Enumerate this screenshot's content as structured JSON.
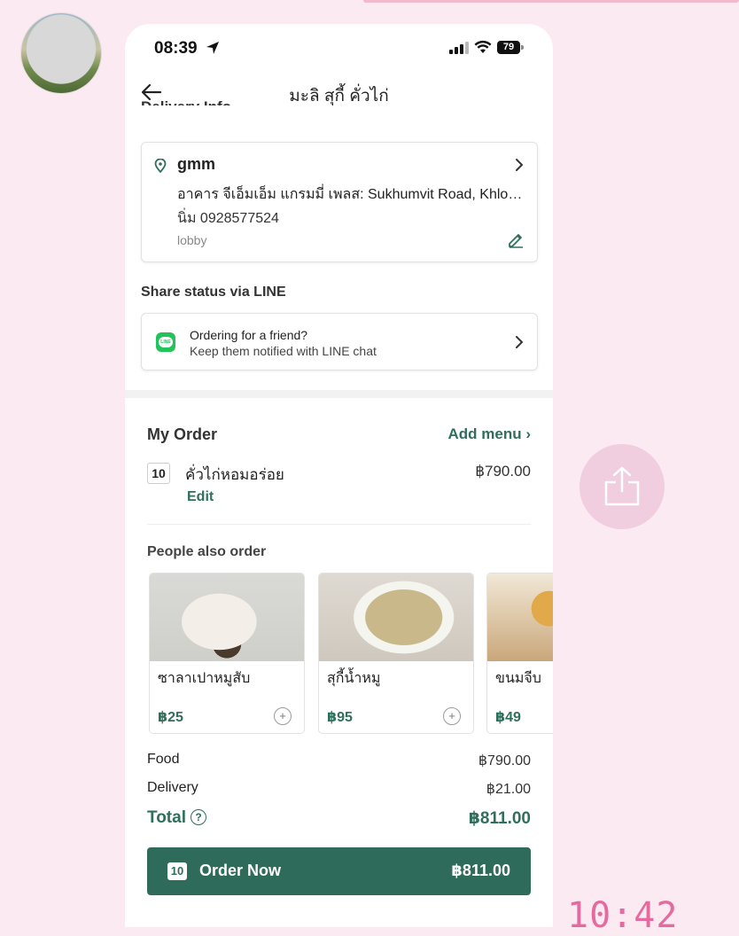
{
  "status_bar": {
    "time": "08:39",
    "battery": "79"
  },
  "nav": {
    "title": "มะลิ สุกี้ คั่วไก่",
    "clipped_heading": "Delivery Info"
  },
  "delivery": {
    "name": "gmm",
    "address": "อาคาร จีเอ็มเอ็ม แกรมมี่ เพลส: Sukhumvit Road, Khlong Toei Nuea",
    "contact": "นิ่ม  0928577524",
    "note": "lobby"
  },
  "share": {
    "label": "Share status via LINE",
    "title": "Ordering for a friend?",
    "subtitle": "Keep them notified with LINE chat"
  },
  "order": {
    "title": "My Order",
    "add_menu": "Add menu",
    "items": [
      {
        "qty": "10",
        "name": "คั่วไก่หอมอร่อย",
        "price": "฿790.00",
        "edit": "Edit"
      }
    ]
  },
  "suggestions": {
    "title": "People also order",
    "items": [
      {
        "name": "ซาลาเปาหมูสับ",
        "price": "฿25"
      },
      {
        "name": "สุกี้น้ำหมู",
        "price": "฿95"
      },
      {
        "name": "ขนมจีบ",
        "price": "฿49"
      }
    ]
  },
  "summary": {
    "food_label": "Food",
    "food_value": "฿790.00",
    "delivery_label": "Delivery",
    "delivery_value": "฿21.00",
    "total_label": "Total",
    "total_value": "฿811.00"
  },
  "cta": {
    "qty": "10",
    "label": "Order Now",
    "amount": "฿811.00"
  },
  "overlay": {
    "clock": "10:42"
  },
  "colors": {
    "accent": "#2f6f5c",
    "background": "#fbeaf1"
  }
}
